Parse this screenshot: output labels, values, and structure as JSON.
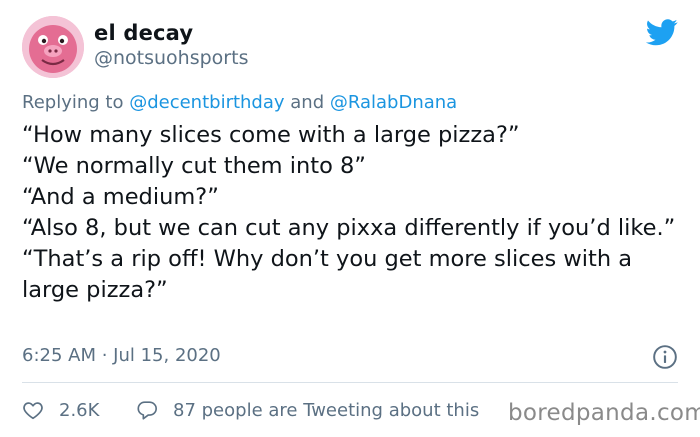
{
  "tweet": {
    "display_name": "el decay",
    "handle": "@notsuohsports",
    "reply_prefix": "Replying to ",
    "reply_to": [
      "@decentbirthday",
      "@RalabDnana"
    ],
    "reply_conjunction": " and ",
    "lines": [
      "“How many slices come with a large pizza?”",
      "“We normally cut them into 8”",
      "“And a medium?”",
      "“Also 8, but we can cut any pixxa differently if you’d like.”",
      "“That’s a rip off! Why don’t you get more slices with a large pizza?”"
    ],
    "timestamp": "6:25 AM · Jul 15, 2020",
    "likes": "2.6K",
    "conversation": "87 people are Tweeting about this"
  },
  "icons": {
    "avatar": "pink-cartoon-face-avatar",
    "platform": "twitter-bird-icon",
    "info": "info-icon",
    "like": "heart-outline-icon",
    "reply": "speech-bubble-icon"
  },
  "colors": {
    "text": "#0f1419",
    "secondary": "#5b7083",
    "link": "#1b95e0",
    "twitter_blue": "#1da1f2"
  },
  "watermark": "boredpanda.com"
}
